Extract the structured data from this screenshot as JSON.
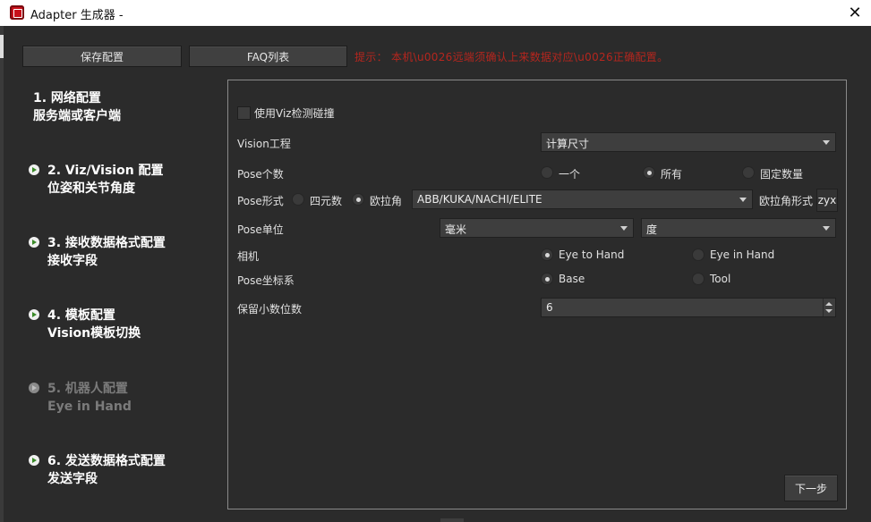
{
  "window": {
    "title": "Adapter 生成器 -",
    "close_glyph": "✕"
  },
  "toolbar": {
    "save_label": "保存配置",
    "faq_label": "FAQ列表",
    "hint": "提示：  本机\\u0026远端须确认上来数据对应\\u0026正确配置。"
  },
  "steps": [
    {
      "line1": "1. 网络配置",
      "line2": "服务端或客户端",
      "icon": "arrow-right-icon",
      "enabled": true,
      "has_arrow": false
    },
    {
      "line1": "2. Viz/Vision 配置",
      "line2": "位姿和关节角度",
      "icon": "arrow-right-icon",
      "enabled": true,
      "has_arrow": true
    },
    {
      "line1": "3. 接收数据格式配置",
      "line2": "接收字段",
      "icon": "arrow-right-icon",
      "enabled": true,
      "has_arrow": true
    },
    {
      "line1": "4. 模板配置",
      "line2": "Vision模板切换",
      "icon": "arrow-right-icon",
      "enabled": true,
      "has_arrow": true
    },
    {
      "line1": "5. 机器人配置",
      "line2": "Eye in Hand",
      "icon": "arrow-right-icon",
      "enabled": false,
      "has_arrow": true
    },
    {
      "line1": "6. 发送数据格式配置",
      "line2": "发送字段",
      "icon": "arrow-right-icon",
      "enabled": true,
      "has_arrow": true
    }
  ],
  "form": {
    "use_viz_label": "使用Viz检测碰撞",
    "use_viz_checked": false,
    "vision_project_label": "Vision工程",
    "vision_project_value": "计算尺寸",
    "pose_count_label": "Pose个数",
    "pose_count_options": [
      "一个",
      "所有",
      "固定数量"
    ],
    "pose_count_selected": "所有",
    "pose_form_label": "Pose形式",
    "pose_form_options": [
      "四元数",
      "欧拉角"
    ],
    "pose_form_selected": "欧拉角",
    "euler_robot_value": "ABB/KUKA/NACHI/ELITE",
    "euler_form_label": "欧拉角形式",
    "euler_form_value": "zyx",
    "pose_unit_label": "Pose单位",
    "pose_unit_length": "毫米",
    "pose_unit_angle": "度",
    "camera_label": "相机",
    "camera_options": [
      "Eye to Hand",
      "Eye in Hand"
    ],
    "camera_selected": "Eye to Hand",
    "pose_frame_label": "Pose坐标系",
    "pose_frame_options": [
      "Base",
      "Tool"
    ],
    "pose_frame_selected": "Base",
    "decimal_label": "保留小数位数",
    "decimal_value": "6"
  },
  "footer": {
    "next_label": "下一步"
  },
  "colors": {
    "background": "#2b2b2b",
    "hint": "#b5261e",
    "step_disabled": "#7b7b7b",
    "arrow_green": "#3a8a28"
  }
}
